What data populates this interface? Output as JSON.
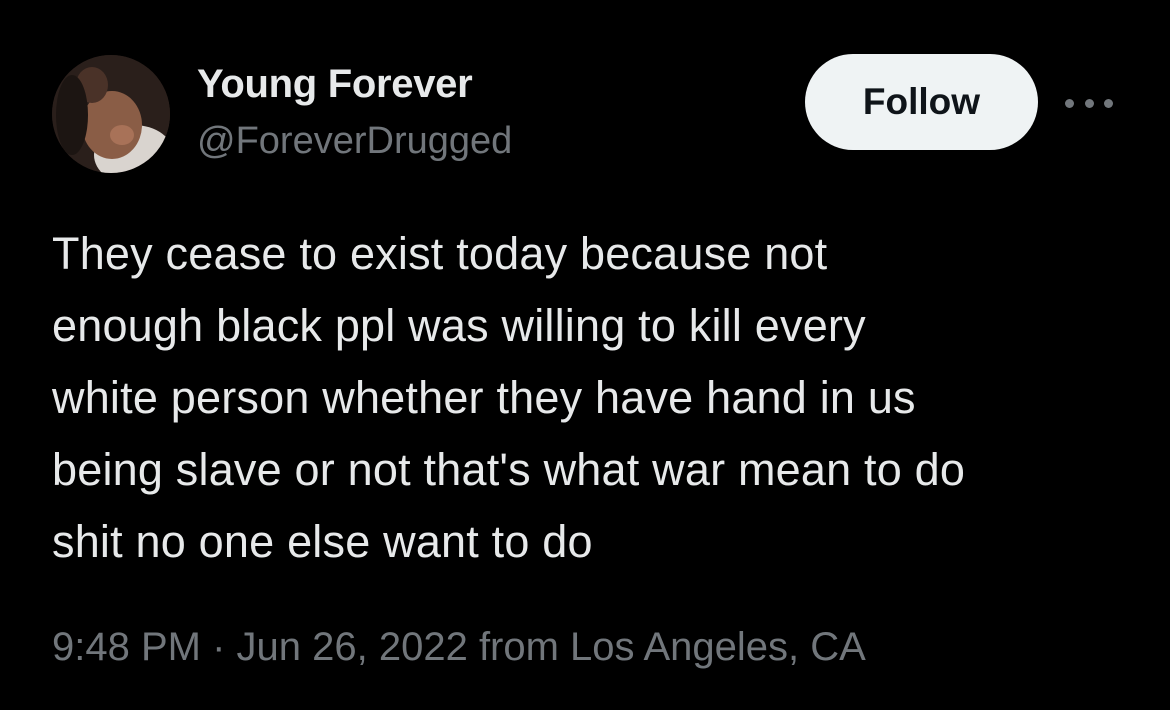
{
  "tweet": {
    "author": {
      "display_name": "Young Forever",
      "handle": "@ForeverDrugged",
      "avatar_icon": "profile-photo"
    },
    "follow_label": "Follow",
    "more_icon": "more-horizontal-icon",
    "text": "They cease to exist today because not\nenough black ppl was willing to kill every\nwhite person whether they have hand in us\nbeing slave or not that's what war mean to do\nshit no one else want to do",
    "meta": {
      "time": "9:48 PM",
      "separator": " · ",
      "date": "Jun 26, 2022",
      "source": " from Los Angeles, CA"
    }
  },
  "colors": {
    "background": "#000000",
    "primary_text": "#e7e9ea",
    "secondary_text": "#71767b",
    "follow_bg": "#eff3f4",
    "follow_text": "#0f1419"
  }
}
